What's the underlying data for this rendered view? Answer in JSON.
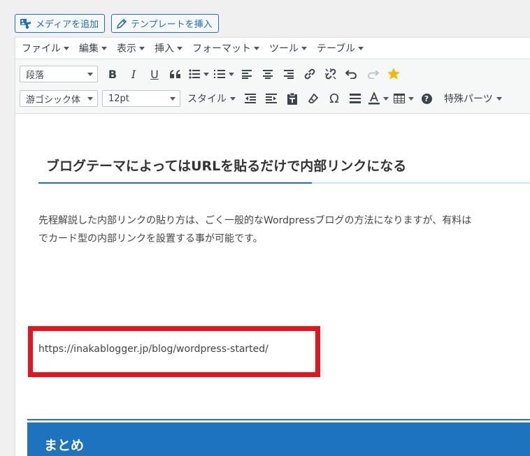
{
  "top_buttons": {
    "media": "メディアを追加",
    "template": "テンプレートを挿入"
  },
  "menubar": [
    {
      "label": "ファイル"
    },
    {
      "label": "編集"
    },
    {
      "label": "表示"
    },
    {
      "label": "挿入"
    },
    {
      "label": "フォーマット"
    },
    {
      "label": "ツール"
    },
    {
      "label": "テーブル"
    }
  ],
  "toolbar": {
    "block_format": "段落",
    "font_family": "游ゴシック体",
    "font_size": "12pt",
    "styles_label": "スタイル",
    "special_parts_label": "特殊パーツ",
    "bold": "B",
    "italic": "I",
    "underline": "U",
    "omega": "Ω",
    "help": "?"
  },
  "content": {
    "heading": "ブログテーマによってはURLを貼るだけで内部リンクになる",
    "paragraph_line1": "先程解説した内部リンクの貼り方は、ごく一般的なWordpressブログの方法になりますが、有料は",
    "paragraph_line2": "でカード型の内部リンクを設置する事が可能です。",
    "url": "https://inakablogger.jp/blog/wordpress-started/",
    "summary_heading": "まとめ"
  },
  "colors": {
    "accent_blue": "#1e73be",
    "highlight_red": "#e6141e",
    "star": "#f5b800"
  }
}
